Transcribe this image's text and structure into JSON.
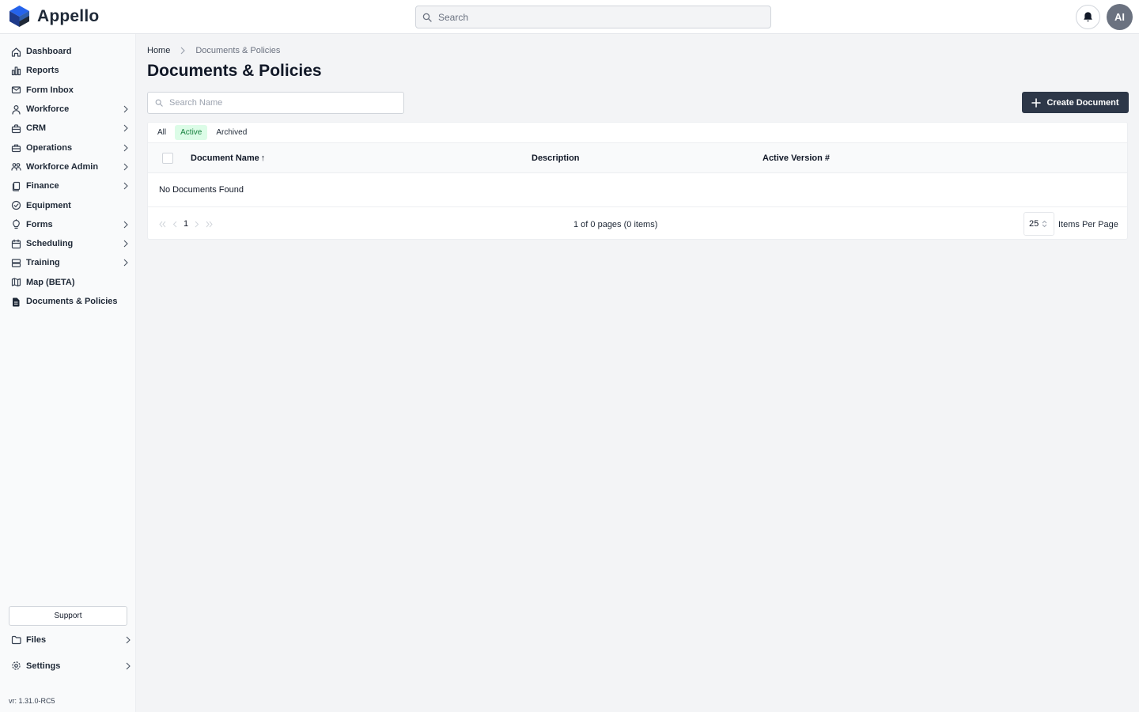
{
  "app": {
    "name": "Appello",
    "brand_color": "#2563eb"
  },
  "header": {
    "search_placeholder": "Search",
    "avatar_initials": "AI"
  },
  "sidebar": {
    "items": [
      {
        "label": "Dashboard",
        "icon": "home-icon",
        "has_children": false
      },
      {
        "label": "Reports",
        "icon": "bar-chart-icon",
        "has_children": false
      },
      {
        "label": "Form Inbox",
        "icon": "mail-icon",
        "has_children": false
      },
      {
        "label": "Workforce",
        "icon": "user-icon",
        "has_children": true
      },
      {
        "label": "CRM",
        "icon": "briefcase-icon",
        "has_children": true
      },
      {
        "label": "Operations",
        "icon": "toolbox-icon",
        "has_children": true
      },
      {
        "label": "Workforce Admin",
        "icon": "users-icon",
        "has_children": true
      },
      {
        "label": "Finance",
        "icon": "documents-icon",
        "has_children": true
      },
      {
        "label": "Equipment",
        "icon": "check-circle-icon",
        "has_children": false
      },
      {
        "label": "Forms",
        "icon": "lightbulb-icon",
        "has_children": true
      },
      {
        "label": "Scheduling",
        "icon": "calendar-icon",
        "has_children": true
      },
      {
        "label": "Training",
        "icon": "layers-icon",
        "has_children": true
      },
      {
        "label": "Map (BETA)",
        "icon": "map-icon",
        "has_children": false
      },
      {
        "label": "Documents & Policies",
        "icon": "document-icon",
        "has_children": false
      }
    ],
    "support_label": "Support",
    "bottom_items": [
      {
        "label": "Files",
        "icon": "folder-icon",
        "has_children": true
      },
      {
        "label": "Settings",
        "icon": "gear-icon",
        "has_children": true
      }
    ],
    "version": "vr: 1.31.0-RC5"
  },
  "main": {
    "breadcrumb": {
      "home": "Home",
      "current": "Documents & Policies"
    },
    "title": "Documents & Policies",
    "search_placeholder": "Search Name",
    "create_label": "Create Document",
    "tabs": [
      {
        "label": "All",
        "active": false
      },
      {
        "label": "Active",
        "active": true
      },
      {
        "label": "Archived",
        "active": false
      }
    ],
    "columns": {
      "name": "Document Name",
      "name_sort": "↑",
      "description": "Description",
      "version": "Active Version #"
    },
    "empty_text": "No Documents Found",
    "pagination": {
      "current_page": "1",
      "info": "1 of 0 pages (0 items)",
      "per_page": "25",
      "per_page_label": "Items Per Page"
    }
  }
}
